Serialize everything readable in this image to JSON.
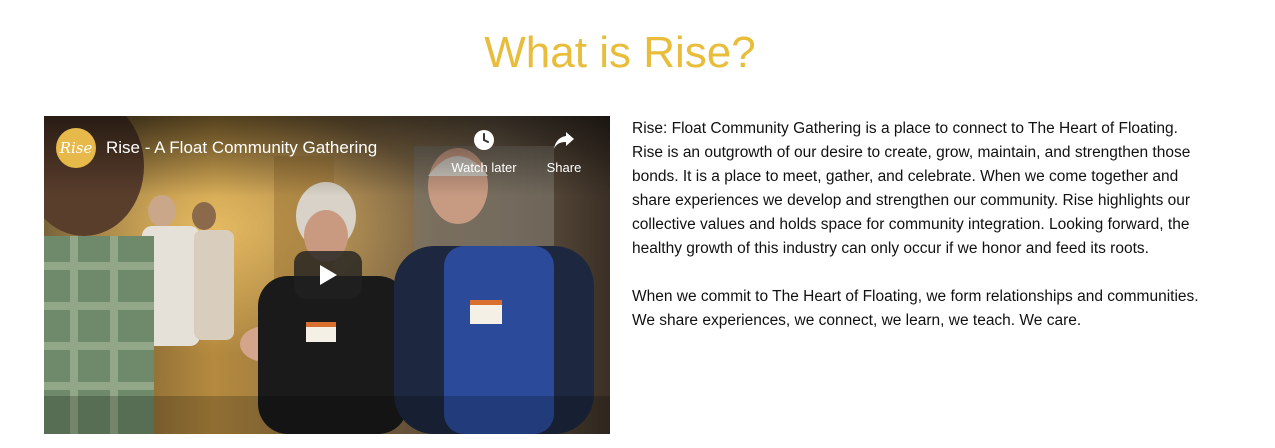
{
  "heading": "What is Rise?",
  "video": {
    "channel_logo_text": "Rise",
    "title": "Rise - A Float Community Gathering",
    "watch_later_label": "Watch later",
    "share_label": "Share",
    "icons": {
      "watch_later": "clock-icon",
      "share": "share-arrow-icon",
      "play": "play-icon"
    }
  },
  "paragraphs": [
    "Rise: Float Community Gathering is a place to connect to The Heart of Floating. Rise is an outgrowth of our desire to create, grow, maintain, and strengthen those bonds. It is a place to meet, gather, and celebrate. When we come together and share experiences we develop and strengthen our community. Rise highlights our collective values and holds space for community integration. Looking forward, the healthy growth of this industry can only occur if we honor and feed its roots.",
    "When we commit to The Heart of Floating, we form relationships and communities. We share experiences, we connect, we learn, we teach. We care."
  ],
  "colors": {
    "heading": "#e8bd3c",
    "text": "#111111",
    "background": "#ffffff"
  }
}
